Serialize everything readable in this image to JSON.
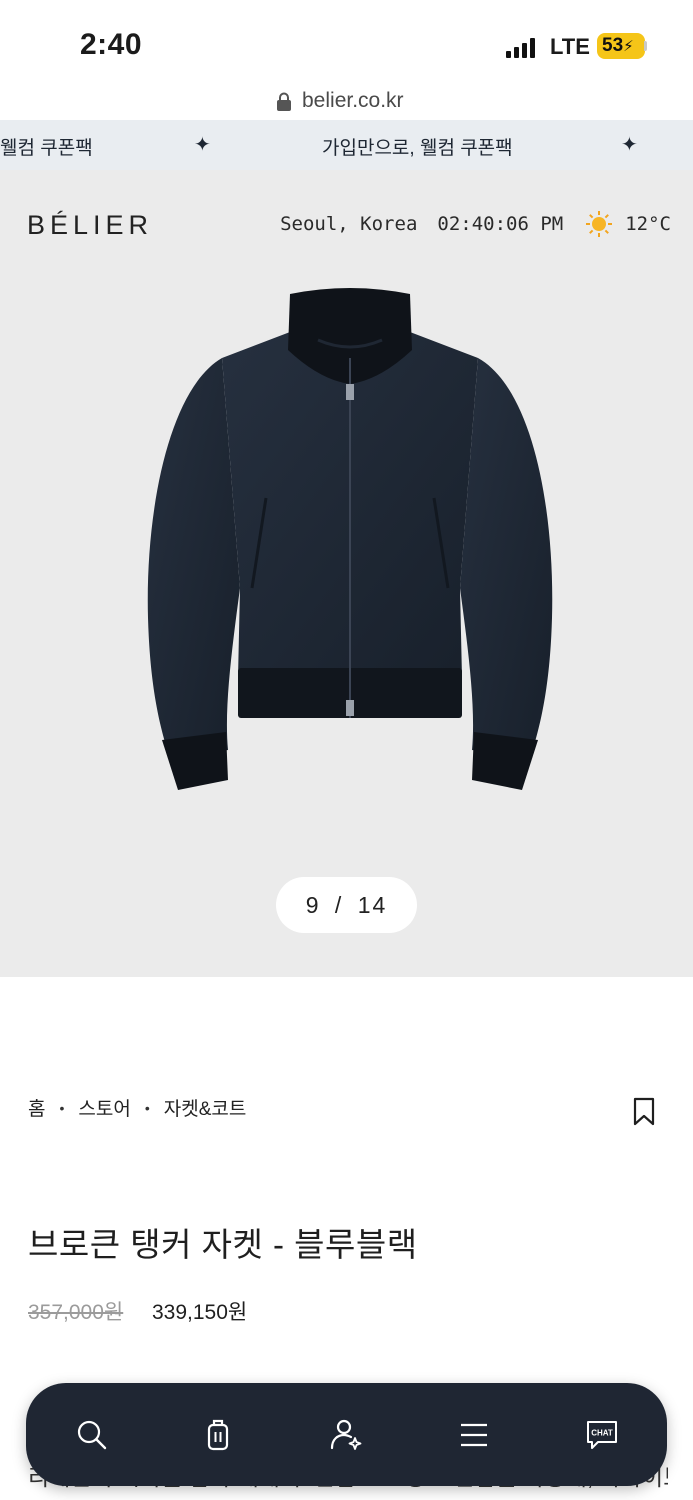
{
  "status_bar": {
    "time": "2:40",
    "network": "LTE",
    "battery": "53"
  },
  "browser": {
    "url": "belier.co.kr"
  },
  "banner": {
    "text_partial": "웰컴 쿠폰팩",
    "text_full": "가입만으로, 웰컴 쿠폰팩",
    "separator": "✦"
  },
  "header": {
    "logo": "BÉLIER",
    "location": "Seoul, Korea",
    "clock": "02:40:06 PM",
    "weather_icon": "sun-icon",
    "temperature": "12°C"
  },
  "gallery": {
    "current": "9",
    "separator": "/",
    "total": "14"
  },
  "breadcrumb": {
    "items": [
      "홈",
      "스토어",
      "자켓&코트"
    ],
    "separator": "•"
  },
  "product": {
    "title": "브로큰 탱커 자켓 - 블루블랙",
    "original_price": "357,000원",
    "sale_price": "339,150원",
    "description_visible": "리에만의 시각을 담아 재해석. 안감으로 방모 안감을 사용해, 아카이브 모"
  },
  "bottom_nav": {
    "items": [
      {
        "name": "search-icon"
      },
      {
        "name": "bag-icon"
      },
      {
        "name": "account-icon"
      },
      {
        "name": "menu-icon"
      },
      {
        "name": "chat-icon",
        "label": "CHAT"
      }
    ]
  },
  "colors": {
    "banner_bg": "#e9edf1",
    "hero_bg": "#ebebeb",
    "nav_bg": "#1f2633",
    "battery": "#f5c518",
    "jacket": "#1c2533"
  }
}
